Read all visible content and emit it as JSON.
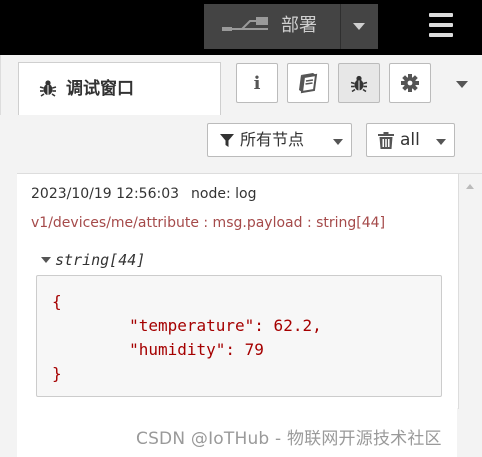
{
  "header": {
    "deploy_label": "部署"
  },
  "sidebar": {
    "tab_title": "调试窗口",
    "buttons": [
      {
        "name": "info",
        "glyph": "i"
      },
      {
        "name": "help",
        "glyph": "book"
      },
      {
        "name": "debug",
        "glyph": "bug",
        "selected": true
      },
      {
        "name": "config",
        "glyph": "gear"
      }
    ]
  },
  "toolbar": {
    "filter_label": "所有节点",
    "clear_label": "all"
  },
  "message": {
    "timestamp": "2023/10/19 12:56:03",
    "node": "node: log",
    "topic": "v1/devices/me/attribute : msg.payload : string[44]",
    "type": "string[44]",
    "value_lines": [
      "{",
      "        \"temperature\": 62.2,",
      "        \"humidity\": 79",
      "}"
    ]
  },
  "watermark": "CSDN @IoTHub - 物联网开源技术社区"
}
